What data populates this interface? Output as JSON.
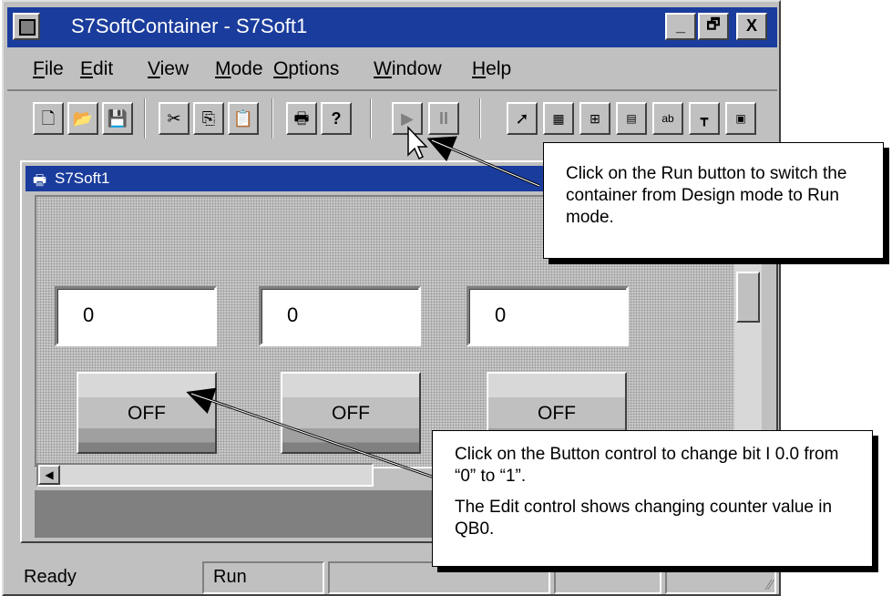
{
  "window": {
    "title": "S7SoftContainer - S7Soft1",
    "caption_buttons": {
      "minimize": "_",
      "restore": "🗗",
      "close": "X"
    }
  },
  "menu": [
    "File",
    "Edit",
    "View",
    "Mode",
    "Options",
    "Window",
    "Help"
  ],
  "menu_mnemonics": [
    "F",
    "E",
    "V",
    "M",
    "O",
    "W",
    "H"
  ],
  "toolbar": {
    "icons": [
      "new-icon",
      "open-icon",
      "save-icon",
      "cut-icon",
      "copy-icon",
      "paste-icon",
      "print-icon",
      "help-icon",
      "run-icon",
      "pause-icon",
      "pointer-icon",
      "control-icon",
      "config-icon",
      "off-icon",
      "abc-icon",
      "tool-icon",
      "tool2-icon"
    ],
    "help_label": "?",
    "pause_label": "II"
  },
  "child_window": {
    "title": "S7Soft1",
    "edits": [
      "0",
      "0",
      "0"
    ],
    "buttons": [
      "OFF",
      "OFF",
      "OFF"
    ]
  },
  "status_bar": {
    "ready": "Ready",
    "mode": "Run"
  },
  "callouts": {
    "run": "Click on the Run button to switch the container from Design mode to Run mode.",
    "button_line1": "Click on the Button control to change bit I 0.0 from “0” to “1”.",
    "button_line2": "The Edit control shows changing counter value in QB0."
  },
  "colors": {
    "title_bar": "#1a3c9c",
    "face": "#c0c0c0"
  }
}
